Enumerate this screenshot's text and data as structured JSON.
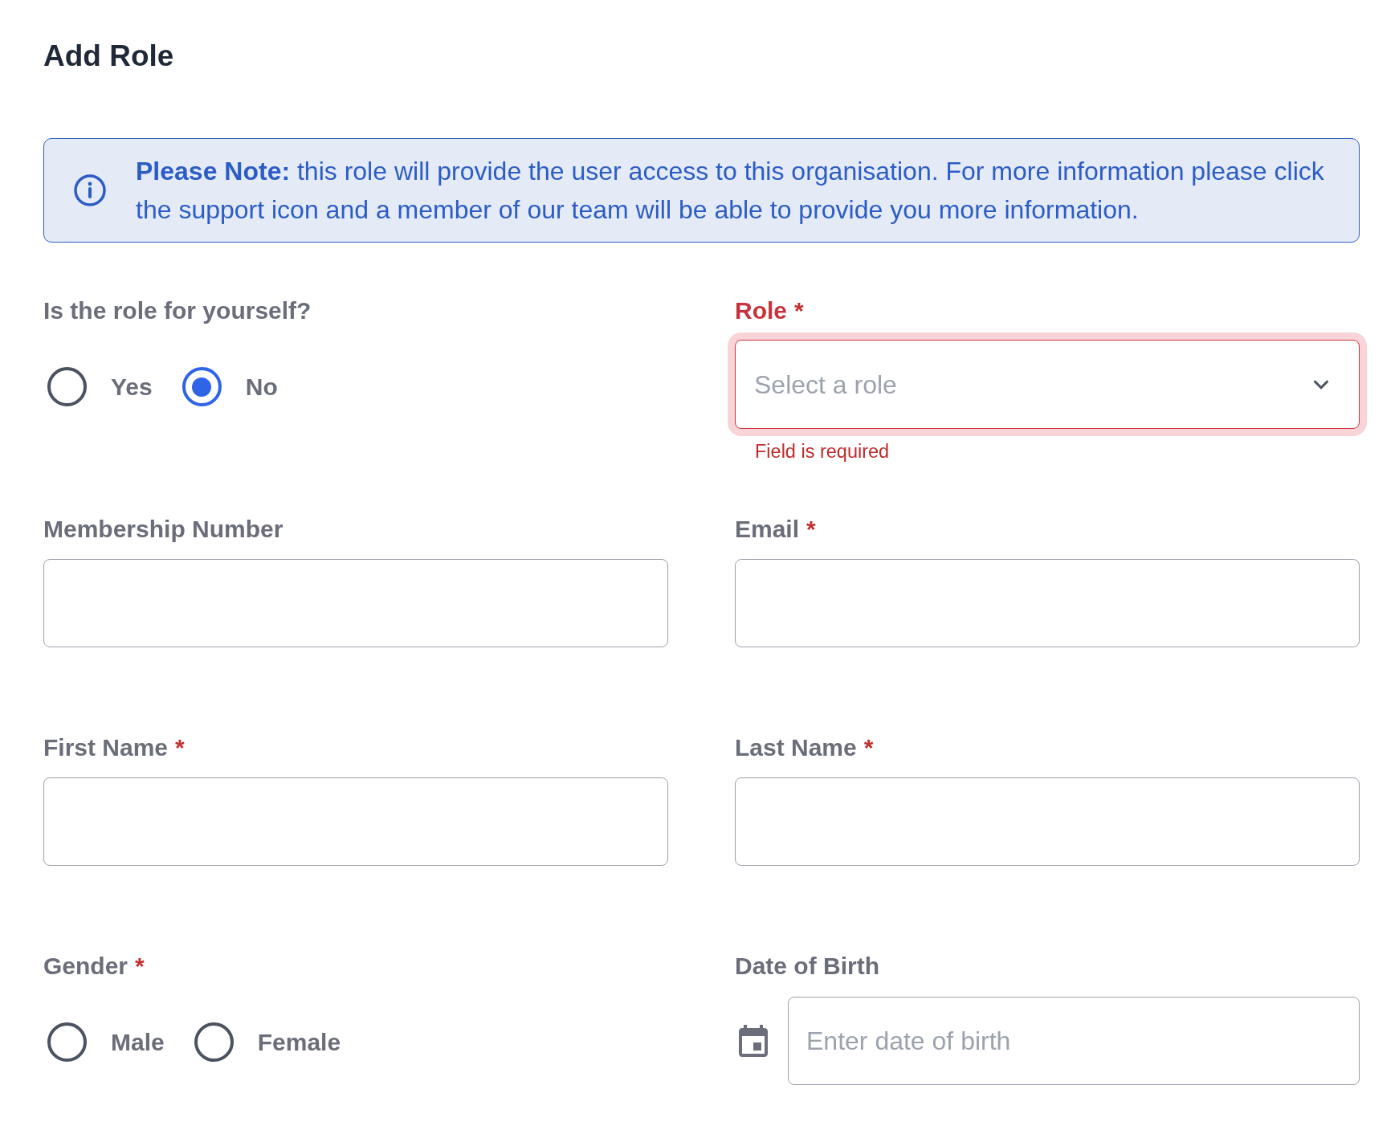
{
  "title": "Add Role",
  "note": {
    "text": "**Please Note:** this role will provide the user access to this organisation. For more information please click the support icon and a member of our team will be able to provide you more information."
  },
  "fields": [
    {
      "kind": "radio",
      "label": "Is the role for yourself?",
      "options": [
        {
          "label": "Yes",
          "selected": false
        },
        {
          "label": "No",
          "selected": true
        }
      ]
    },
    {
      "kind": "select",
      "label": "Role",
      "required_mark": "*",
      "invalid": true,
      "placeholder": "Select a role",
      "error": "Field is required"
    },
    {
      "kind": "text",
      "label": "Membership Number"
    },
    {
      "kind": "text",
      "label": "Email",
      "required_mark": "*"
    },
    {
      "kind": "text",
      "label": "First Name",
      "required_mark": "*"
    },
    {
      "kind": "text",
      "label": "Last Name",
      "required_mark": "*"
    },
    {
      "kind": "radio",
      "label": "Gender",
      "required_mark": "*",
      "options": [
        {
          "label": "Male",
          "selected": false
        },
        {
          "label": "Female",
          "selected": false
        }
      ]
    },
    {
      "kind": "date",
      "label": "Date of Birth",
      "placeholder": "Enter date of birth"
    }
  ]
}
